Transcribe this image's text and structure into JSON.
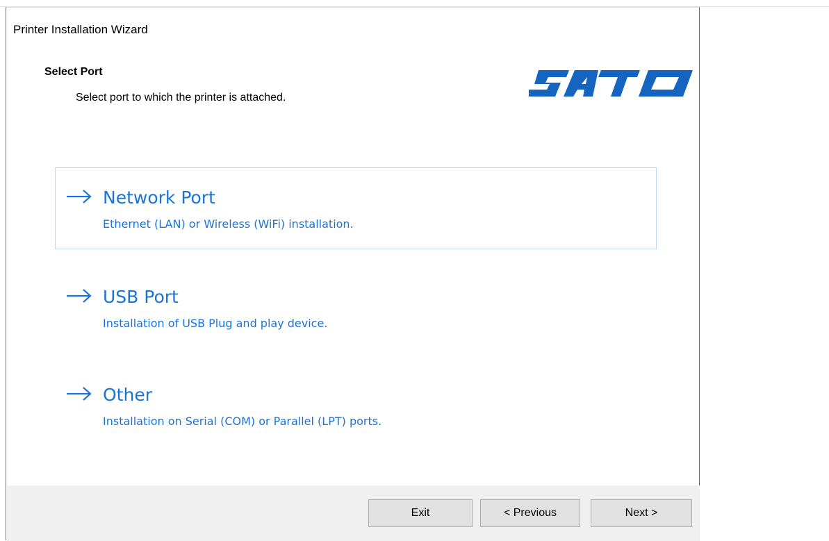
{
  "window": {
    "title": "Printer Installation Wizard"
  },
  "header": {
    "title": "Select Port",
    "subtitle": "Select port to which the printer is attached.",
    "logo_text": "SATO"
  },
  "options": [
    {
      "title": "Network Port",
      "description": "Ethernet (LAN) or Wireless (WiFi) installation.",
      "selected": true,
      "icon": "arrow-right-icon"
    },
    {
      "title": "USB Port",
      "description": "Installation of USB Plug and play device.",
      "selected": false,
      "icon": "arrow-right-icon"
    },
    {
      "title": "Other",
      "description": "Installation on Serial (COM) or Parallel (LPT) ports.",
      "selected": false,
      "icon": "arrow-right-icon"
    }
  ],
  "footer": {
    "exit_label": "Exit",
    "previous_label": "< Previous",
    "next_label": "Next >"
  },
  "colors": {
    "link_blue": "#1a73d9",
    "logo_blue": "#1565c0",
    "selection_border": "#bcd9f3",
    "footer_bg": "#f0f0f0",
    "button_bg": "#e1e1e1"
  }
}
